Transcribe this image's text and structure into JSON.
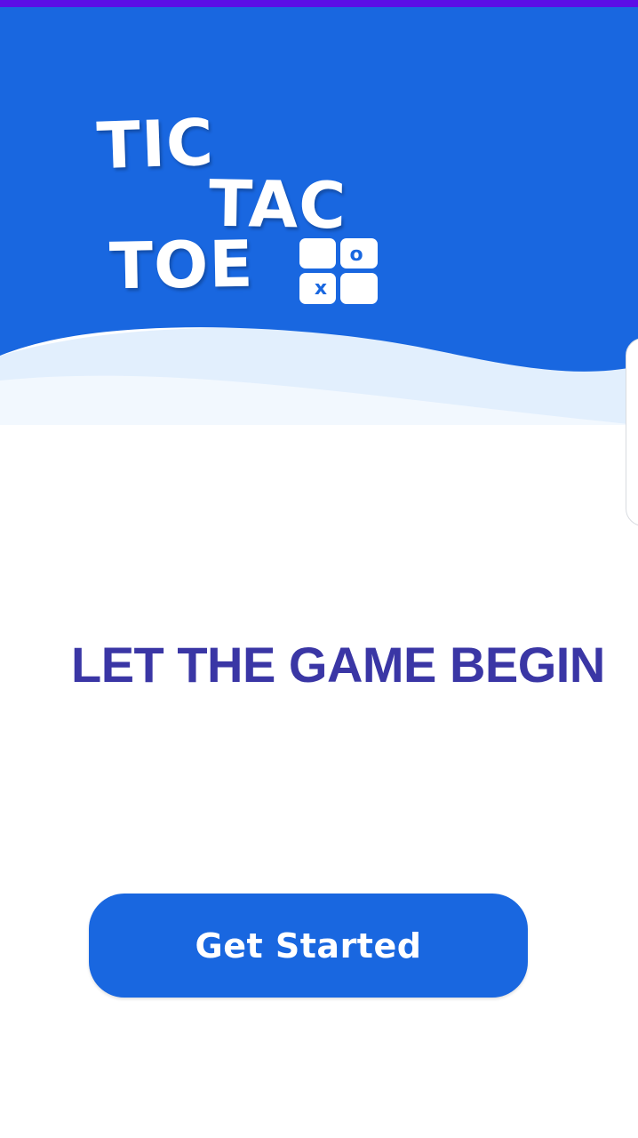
{
  "colors": {
    "status_strip": "#5b0ee6",
    "primary": "#1967e0",
    "wave_light": "#e2effd",
    "wave_lighter": "#f2f8fe",
    "tagline": "#3a36a5",
    "white": "#ffffff"
  },
  "logo": {
    "line1": "TIC",
    "line2": "TAC",
    "line3": "TOE",
    "grid_icon": "tic-tac-toe-grid-icon",
    "grid_marks": {
      "o": "o",
      "x": "x"
    }
  },
  "main": {
    "tagline": "LET THE GAME BEGIN",
    "button_label": "Get Started"
  }
}
